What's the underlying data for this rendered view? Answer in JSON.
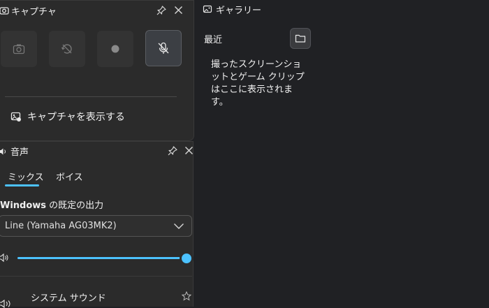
{
  "capture": {
    "title": "キャプチャ",
    "show_capture_label": "キャプチャを表示する"
  },
  "audio": {
    "title": "音声",
    "tabs": [
      {
        "label": "ミックス",
        "selected": true
      },
      {
        "label": "ボイス",
        "selected": false
      }
    ],
    "default_output_bold": "Windows",
    "default_output_rest": " の既定の出力",
    "device_selected": "Line (Yamaha AG03MK2)",
    "volume_percent": 100,
    "app_row_label": "システム サウンド"
  },
  "gallery": {
    "title": "ギャラリー",
    "recent_label": "最近",
    "empty_message": "撮ったスクリーンショットとゲーム クリップはここに表示されます。"
  },
  "colors": {
    "accent": "#4cc2ff",
    "panel_bg": "#2b2b2b",
    "page_bg": "#202124"
  }
}
